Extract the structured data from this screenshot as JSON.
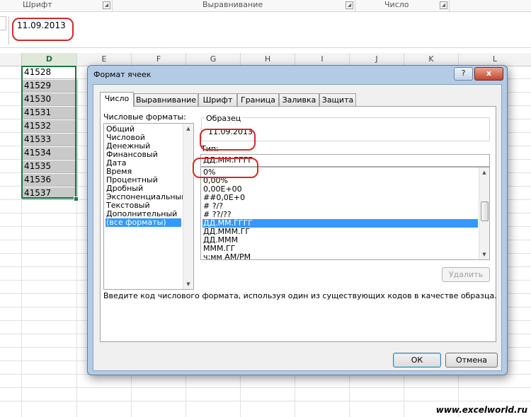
{
  "ribbon": {
    "groups": [
      "Шрифт",
      "Выравнивание",
      "Число"
    ]
  },
  "formula_bar": {
    "value": "11.09.2013"
  },
  "sheet": {
    "columns": [
      "D",
      "E",
      "F",
      "G",
      "H",
      "I",
      "J",
      "K",
      "L"
    ],
    "selected_column": "D",
    "cells": [
      "41528",
      "41529",
      "41530",
      "41531",
      "41532",
      "41533",
      "41534",
      "41535",
      "41536",
      "41537"
    ]
  },
  "dialog": {
    "title": "Формат ячеек",
    "help_label": "?",
    "close_label": "x",
    "tabs": [
      "Число",
      "Выравнивание",
      "Шрифт",
      "Граница",
      "Заливка",
      "Защита"
    ],
    "active_tab": "Число",
    "categories_label": "Числовые форматы:",
    "categories": [
      "Общий",
      "Числовой",
      "Денежный",
      "Финансовый",
      "Дата",
      "Время",
      "Процентный",
      "Дробный",
      "Экспоненциальный",
      "Текстовый",
      "Дополнительный",
      "(все форматы)"
    ],
    "selected_category": "(все форматы)",
    "sample_label": "Образец",
    "sample_value": "11.09.2013",
    "type_label": "Тип:",
    "type_value": "ДД.ММ.ГГГГ",
    "formats": [
      "0%",
      "0,00%",
      "0,00E+00",
      "##0,0E+0",
      "# ?/?",
      "# ??/??",
      "ДД.ММ.ГГГГ",
      "ДД.МММ.ГГ",
      "ДД.МММ",
      "МММ.ГГ",
      "ч:мм AM/PM"
    ],
    "selected_format": "ДД.ММ.ГГГГ",
    "delete_label": "Удалить",
    "hint": "Введите код числового формата, используя один из существующих кодов в качестве образца.",
    "ok_label": "ОК",
    "cancel_label": "Отмена"
  },
  "watermark": "www.excelworld.ru",
  "colors": {
    "excel_green": "#217346",
    "annotation_red": "#d12a2a",
    "selection_blue": "#3399ff"
  }
}
